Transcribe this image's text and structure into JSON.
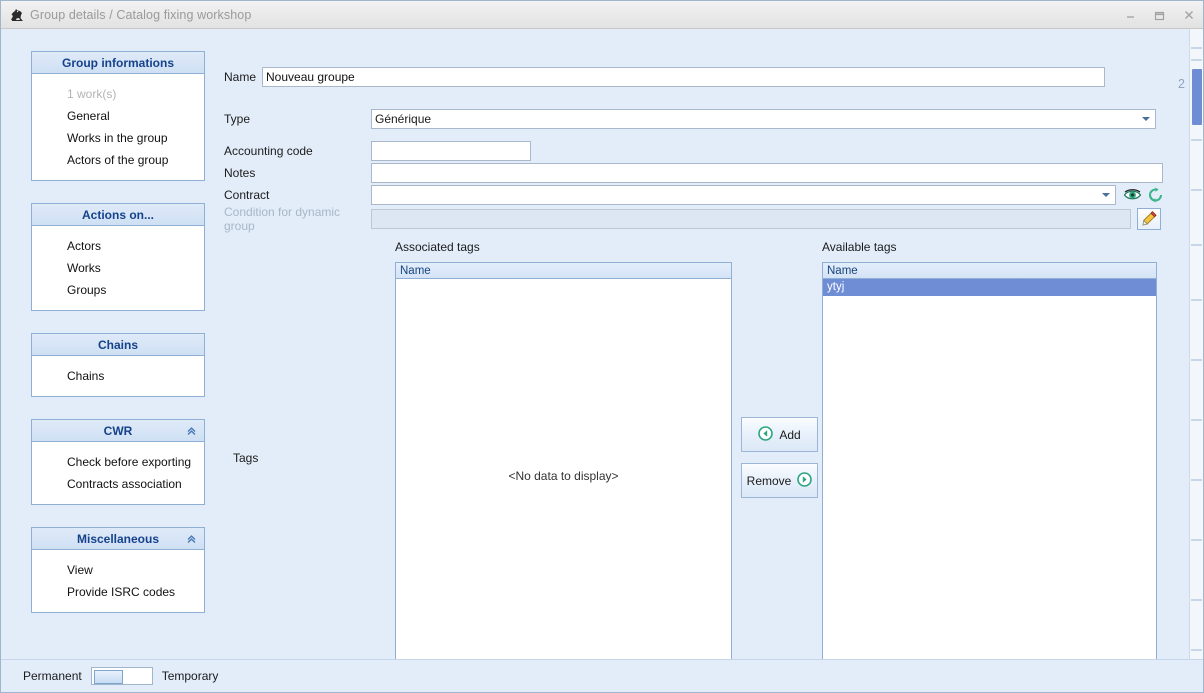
{
  "window": {
    "title": "Group details / Catalog fixing workshop",
    "app_icon": "horse-icon",
    "minimize": "minimize-icon",
    "maximize": "maximize-icon",
    "close": "close-icon"
  },
  "sidebar": {
    "panels": [
      {
        "title": "Group informations",
        "collapsible": false,
        "items": [
          {
            "label": "1 work(s)",
            "muted": true
          },
          {
            "label": "General",
            "muted": false
          },
          {
            "label": "Works in the group",
            "muted": false
          },
          {
            "label": "Actors of the group",
            "muted": false
          }
        ]
      },
      {
        "title": "Actions on...",
        "collapsible": false,
        "items": [
          {
            "label": "Actors",
            "muted": false
          },
          {
            "label": "Works",
            "muted": false
          },
          {
            "label": "Groups",
            "muted": false
          }
        ]
      },
      {
        "title": "Chains",
        "collapsible": false,
        "items": [
          {
            "label": "Chains",
            "muted": false
          }
        ]
      },
      {
        "title": "CWR",
        "collapsible": true,
        "items": [
          {
            "label": "Check before exporting",
            "muted": false
          },
          {
            "label": "Contracts association",
            "muted": false
          }
        ]
      },
      {
        "title": "Miscellaneous",
        "collapsible": true,
        "items": [
          {
            "label": "View",
            "muted": false
          },
          {
            "label": "Provide ISRC codes",
            "muted": false
          }
        ]
      }
    ]
  },
  "form": {
    "name_label": "Name",
    "name_value": "Nouveau groupe",
    "name_placeholder": "",
    "counter": "2",
    "type_label": "Type",
    "type_value": "Générique",
    "accounting_label": "Accounting code",
    "accounting_value": "",
    "notes_label": "Notes",
    "notes_value": "",
    "contract_label": "Contract",
    "contract_value": "",
    "condition_label": "Condition for dynamic group",
    "condition_value": "",
    "eye_icon": "eye-icon",
    "refresh_icon": "refresh-icon",
    "edit_icon": "pencil-icon"
  },
  "tags": {
    "section_label": "Tags",
    "associated": {
      "caption": "Associated tags",
      "column": "Name",
      "rows": [],
      "empty_text": "<No data to display>"
    },
    "available": {
      "caption": "Available tags",
      "column": "Name",
      "rows": [
        {
          "name": "ytyj",
          "selected": true
        }
      ]
    },
    "add_button": "Add",
    "remove_button": "Remove",
    "add_icon": "arrow-left-circle-icon",
    "remove_icon": "arrow-right-circle-icon"
  },
  "footer": {
    "left_label": "Permanent",
    "right_label": "Temporary",
    "toggle_position": "left"
  },
  "colors": {
    "accent": "#15428b",
    "background": "#e3edfa",
    "panel_border": "#8fb0d4",
    "selection": "#6e8dd5",
    "green": "#2aa57f",
    "muted_text": "#b4b4b4"
  }
}
